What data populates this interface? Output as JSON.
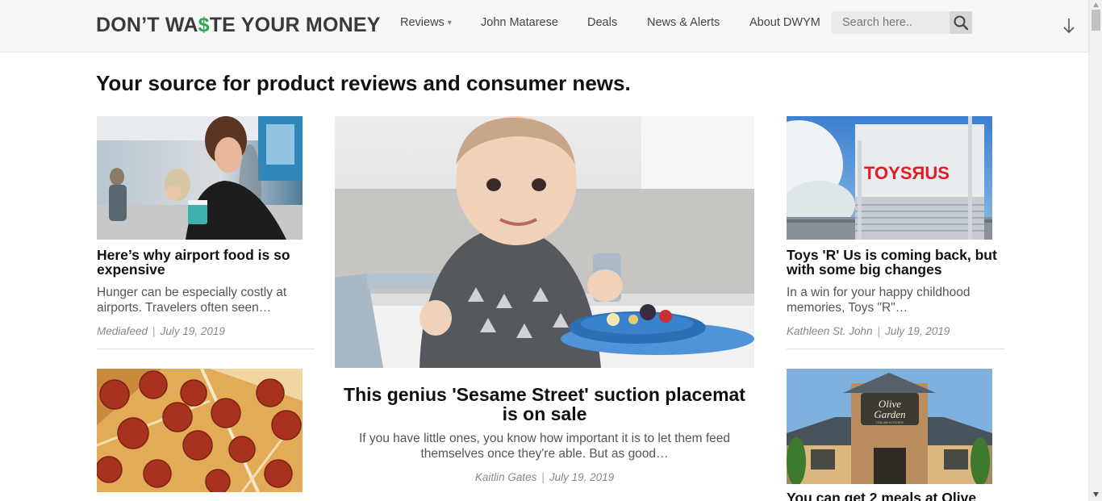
{
  "header": {
    "logo_pre": "DON’T WA",
    "logo_dollar": "$",
    "logo_post": "TE YOUR MONEY",
    "nav": [
      {
        "label": "Reviews",
        "has_caret": true
      },
      {
        "label": "John Matarese"
      },
      {
        "label": "Deals"
      },
      {
        "label": "News & Alerts"
      },
      {
        "label": "About DWYM"
      }
    ],
    "caret": "▾",
    "search_placeholder": "Search here.."
  },
  "page_heading": "Your source for product reviews and consumer news.",
  "cards": [
    {
      "title": "Here’s why airport food is so expensive",
      "excerpt": "Hunger can be especially costly at airports. Travelers often seen…",
      "author": "Mediafeed",
      "date": "July 19, 2019"
    },
    {
      "title": "Toys 'R' Us is coming back, but with some big changes",
      "excerpt": "In a win for your happy childhood memories, Toys \"R\"…",
      "author": "Kathleen St. John",
      "date": "July 19, 2019"
    },
    {
      "title": "You can get 2 meals at Olive"
    }
  ],
  "feature": {
    "title": "This genius 'Sesame Street' suction placemat is on sale",
    "excerpt": "If you have little ones, you know how important it is to let them feed themselves once they're able. But as good…",
    "author": "Kaitlin Gates",
    "date": "July 19, 2019"
  },
  "images": {
    "toysrus_sign": "TOYSЯUS",
    "olive_garden_line1": "Olive",
    "olive_garden_line2": "Garden",
    "olive_garden_sub": "ITALIAN KITCHEN"
  },
  "separator": "|",
  "colors": {
    "brand_green": "#2fa84f",
    "header_bg": "#f7f7f7",
    "toysrus_red": "#e31b23",
    "toysrus_blue": "#1f4ea1"
  },
  "icons": {
    "search": "search-icon",
    "scroll_down": "arrow-down-icon"
  }
}
